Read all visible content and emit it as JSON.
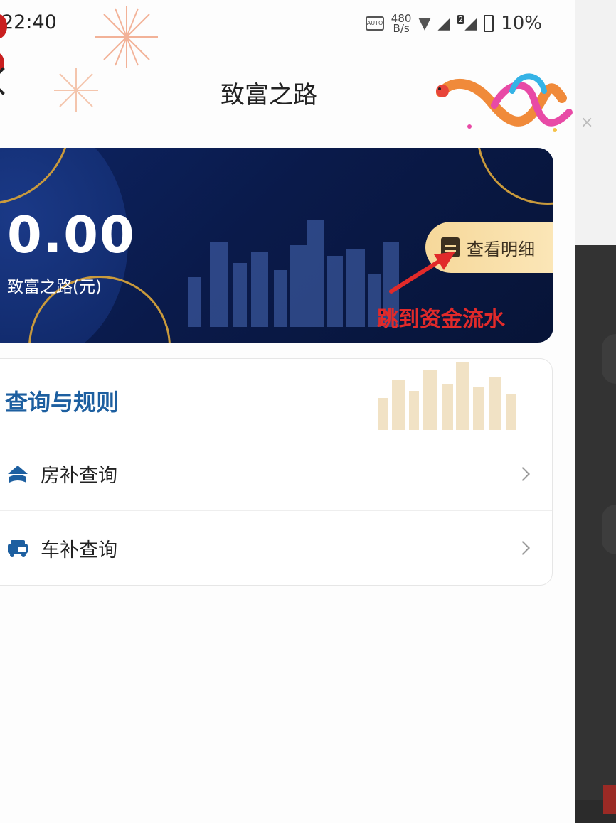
{
  "status_bar": {
    "time": "22:40",
    "network_badge": "AUTO",
    "speed_value": "480",
    "speed_unit": "B/s",
    "sim_badge": "2",
    "battery": "10%"
  },
  "header": {
    "title": "致富之路",
    "back_icon": "chevron-left-icon"
  },
  "balance_card": {
    "amount": "0.00",
    "label": "致富之路(元)",
    "detail_button": "查看明细",
    "annotation": "跳到资金流水"
  },
  "rules": {
    "title": "查询与规则",
    "items": [
      {
        "label": "房补查询",
        "icon": "house-subsidy-icon"
      },
      {
        "label": "车补查询",
        "icon": "car-subsidy-icon"
      }
    ]
  },
  "colors": {
    "card_bg": "#0a1a4a",
    "accent_gold": "#f6d89a",
    "rules_title": "#1d5fa0",
    "annotation_red": "#e12a2a"
  }
}
